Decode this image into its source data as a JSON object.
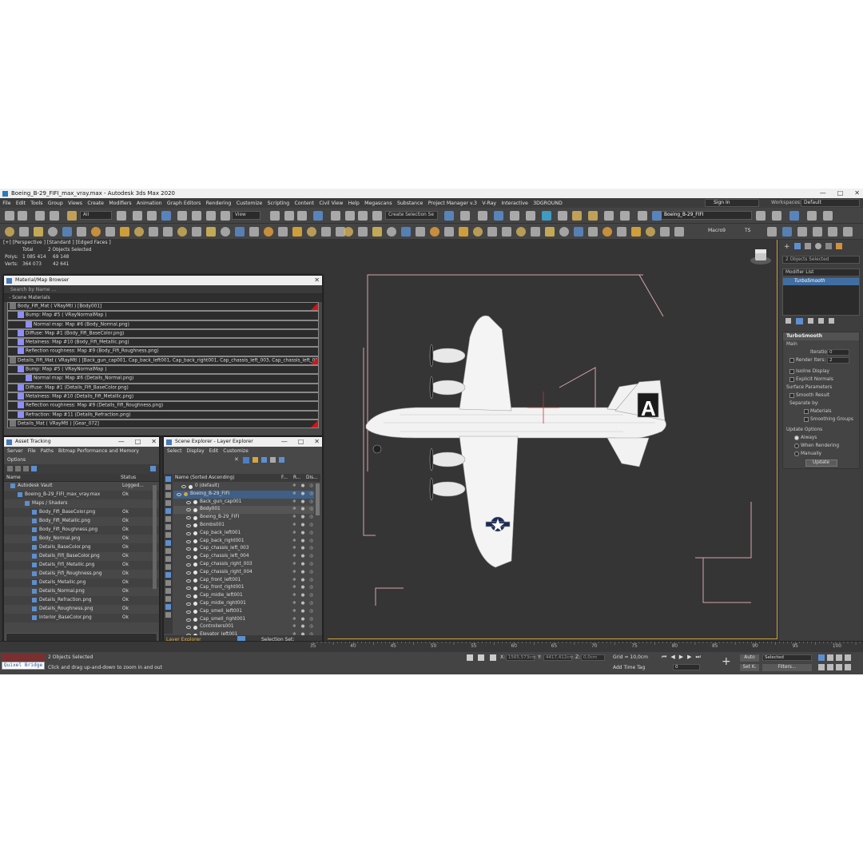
{
  "window": {
    "title": "Boeing_B-29_FIFI_max_vray.max - Autodesk 3ds Max 2020",
    "controls": [
      "—",
      "□",
      "✕"
    ]
  },
  "menubar": {
    "items": [
      "File",
      "Edit",
      "Tools",
      "Group",
      "Views",
      "Create",
      "Modifiers",
      "Animation",
      "Graph Editors",
      "Rendering",
      "Customize",
      "Scripting",
      "Content",
      "Civil View",
      "Help",
      "Megascans",
      "Substance",
      "Project Manager v.3",
      "V-Ray",
      "Interactive",
      "3DGROUND"
    ],
    "sign_in": "Sign In",
    "workspaces_label": "Workspaces:",
    "workspace_value": "Default"
  },
  "toolbar": {
    "filter_all": "All",
    "view_dropdown": "View",
    "create_selection_set": "Create Selection Se",
    "layer_field": "Boeing_B-29_FIFI",
    "macro": "Macro9",
    "ts": "TS"
  },
  "viewport": {
    "label": "[+] [Perspective ] [Standard ] [Edged Faces ]",
    "stats_header": [
      "",
      "Total",
      "2 Objects Selected"
    ],
    "stats": [
      {
        "name": "Polys:",
        "total": "1 085 414",
        "selected": "69 148"
      },
      {
        "name": "Verts:",
        "total": "364 073",
        "selected": "42 641"
      }
    ]
  },
  "material_browser": {
    "title": "Material/Map Browser",
    "search_placeholder": "Search by Name ...",
    "section": "- Scene Materials",
    "rows": [
      {
        "text": "Body_Fifi_Mat  ( VRayMtl )  [Body001]",
        "indent": 0,
        "red": true
      },
      {
        "text": "Bump: Map #5  ( VRayNormalMap )",
        "indent": 1
      },
      {
        "text": "Normal map: Map #6 (Body_Normal.png)",
        "indent": 2
      },
      {
        "text": "Diffuse: Map #1 (Body_Fifi_BaseColor.png)",
        "indent": 1
      },
      {
        "text": "Metalness: Map #10 (Body_Fifi_Metallic.png)",
        "indent": 1
      },
      {
        "text": "Reflection roughness: Map #9 (Body_Fifi_Roughness.png)",
        "indent": 1
      },
      {
        "text": "Details_Fifi_Mat  ( VRayMtl )  [Back_gun_cap001, Cap_back_left001, Cap_back_right001, Cap_chassis_left_003, Cap_chassis_left_004...",
        "indent": 0,
        "red": true
      },
      {
        "text": "Bump: Map #5  ( VRayNormalMap )",
        "indent": 1
      },
      {
        "text": "Normal map: Map #6 (Details_Normal.png)",
        "indent": 2
      },
      {
        "text": "Diffuse: Map #1 (Details_Fifi_BaseColor.png)",
        "indent": 1
      },
      {
        "text": "Metalness: Map #10 (Details_Fifi_Metallic.png)",
        "indent": 1
      },
      {
        "text": "Reflection roughness: Map #9 (Details_Fifi_Roughness.png)",
        "indent": 1
      },
      {
        "text": "Refraction: Map #11 (Details_Refraction.png)",
        "indent": 1
      },
      {
        "text": "Details_Mat  ( VRayMtl )  [Gear_072]",
        "indent": 0,
        "red": true
      }
    ]
  },
  "asset_tracking": {
    "title": "Asset Tracking",
    "menu": [
      "Server",
      "File",
      "Paths",
      "Bitmap Performance and Memory"
    ],
    "options": "Options",
    "col_name": "Name",
    "col_status": "Status",
    "rows": [
      {
        "name": "Autodesk Vault",
        "status": "Logged...",
        "indent": 0
      },
      {
        "name": "Boeing_B-29_FIFI_max_vray.max",
        "status": "Ok",
        "indent": 1
      },
      {
        "name": "Maps / Shaders",
        "status": "",
        "indent": 2
      },
      {
        "name": "Body_Fifi_BaseColor.png",
        "status": "Ok",
        "indent": 3
      },
      {
        "name": "Body_Fifi_Metallic.png",
        "status": "Ok",
        "indent": 3
      },
      {
        "name": "Body_Fifi_Roughness.png",
        "status": "Ok",
        "indent": 3
      },
      {
        "name": "Body_Normal.png",
        "status": "Ok",
        "indent": 3
      },
      {
        "name": "Details_BaseColor.png",
        "status": "Ok",
        "indent": 3
      },
      {
        "name": "Details_Fifi_BaseColor.png",
        "status": "Ok",
        "indent": 3
      },
      {
        "name": "Details_Fifi_Metallic.png",
        "status": "Ok",
        "indent": 3
      },
      {
        "name": "Details_Fifi_Roughness.png",
        "status": "Ok",
        "indent": 3
      },
      {
        "name": "Details_Metallic.png",
        "status": "Ok",
        "indent": 3
      },
      {
        "name": "Details_Normal.png",
        "status": "Ok",
        "indent": 3
      },
      {
        "name": "Details_Refraction.png",
        "status": "Ok",
        "indent": 3
      },
      {
        "name": "Details_Roughness.png",
        "status": "Ok",
        "indent": 3
      },
      {
        "name": "Interior_BaseColor.png",
        "status": "Ok",
        "indent": 3
      }
    ]
  },
  "scene_explorer": {
    "title": "Scene Explorer - Layer Explorer",
    "menu": [
      "Select",
      "Display",
      "Edit",
      "Customize"
    ],
    "col_name": "Name (Sorted Ascending)",
    "col_f": "F...",
    "col_r": "R...",
    "col_dis": "Dis...",
    "rows": [
      {
        "name": "0 (default)",
        "indent": 1
      },
      {
        "name": "Boeing_B-29_FIFI",
        "indent": 0,
        "selected": true
      },
      {
        "name": "Back_gun_cap001",
        "indent": 2
      },
      {
        "name": "Body001",
        "indent": 2,
        "highlight": true
      },
      {
        "name": "Boeing_B-29_FIFI",
        "indent": 2
      },
      {
        "name": "Bombs001",
        "indent": 2
      },
      {
        "name": "Cap_back_left001",
        "indent": 2
      },
      {
        "name": "Cap_back_right001",
        "indent": 2
      },
      {
        "name": "Cap_chassis_left_003",
        "indent": 2
      },
      {
        "name": "Cap_chassis_left_004",
        "indent": 2
      },
      {
        "name": "Cap_chassis_right_003",
        "indent": 2
      },
      {
        "name": "Cap_chassis_right_004",
        "indent": 2
      },
      {
        "name": "Cap_front_left001",
        "indent": 2
      },
      {
        "name": "Cap_front_right001",
        "indent": 2
      },
      {
        "name": "Cap_midle_left001",
        "indent": 2
      },
      {
        "name": "Cap_midle_right001",
        "indent": 2
      },
      {
        "name": "Cap_smell_left001",
        "indent": 2
      },
      {
        "name": "Cap_smell_right001",
        "indent": 2
      },
      {
        "name": "Controllers001",
        "indent": 2
      },
      {
        "name": "Elevator_left001",
        "indent": 2
      }
    ],
    "footer_left": "Layer Explorer",
    "footer_right": "Selection Set:"
  },
  "command_panel": {
    "selected_field": "2 Objects Selected",
    "modifier_list": "Modifier List",
    "modifier_stack_item": "TurboSmooth",
    "rollout_title": "TurboSmooth",
    "main": "Main",
    "iterations_label": "Iterations:",
    "iterations_value": "0",
    "render_iters_label": "Render Iters:",
    "render_iters_value": "2",
    "isoline_display": "Isoline Display",
    "explicit_normals": "Explicit Normals",
    "surface_parameters": "Surface Parameters",
    "smooth_result": "Smooth Result",
    "separate_by": "Separate by:",
    "materials": "Materials",
    "smoothing_groups": "Smoothing Groups",
    "update_options": "Update Options",
    "always": "Always",
    "when_rendering": "When Rendering",
    "manually": "Manually",
    "update_button": "Update"
  },
  "timeline": {
    "ticks": [
      "35",
      "40",
      "45",
      "50",
      "55",
      "60",
      "65",
      "70",
      "75",
      "80",
      "85",
      "90",
      "95",
      "100"
    ]
  },
  "statusbar": {
    "quixel": "Quixel Bridge",
    "objects_selected": "2 Objects Selected",
    "hint": "Click and drag up-and-down to zoom in and out",
    "x_label": "X:",
    "x_value": "1565,573cm",
    "y_label": "Y:",
    "y_value": "4417,412cm",
    "z_label": "Z:",
    "z_value": "0,0cm",
    "grid": "Grid = 10,0cm",
    "add_time_tag": "Add Time Tag",
    "frame": "0",
    "auto": "Auto",
    "selected": "Selected",
    "set_k": "Set K.",
    "filters": "Filters..."
  },
  "colors": {
    "viewport_bg": "#353535",
    "accent_blue": "#3f5f86",
    "frame_gold": "#c9a237",
    "material_swatch": "#8e8efa",
    "red_flag": "#dd1111"
  }
}
